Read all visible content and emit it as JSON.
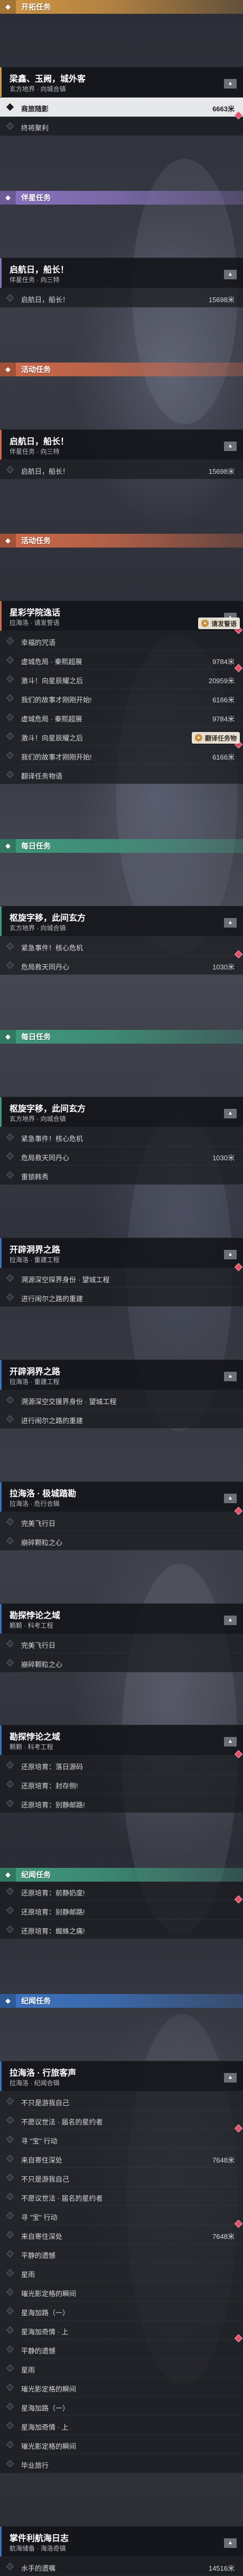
{
  "category_colors": {
    "trailblaze": "#d39744",
    "companion": "#8a74c0",
    "event": "#d06a4a",
    "daily": "#3f9b7e",
    "adventure": "#3c74c2",
    "theme": "#4e8f8a"
  },
  "location_tags": [
    "请发誓语",
    "翻译任务物"
  ],
  "rows": [
    {
      "type": "cat",
      "style": "trailblaze",
      "icon": "⬥",
      "label": "开拓任务"
    },
    {
      "type": "head",
      "style": "trailblaze",
      "title": "梁鑫、玉阙，城外客",
      "subtitle": "玄方地界 · 向城合镇"
    },
    {
      "type": "item",
      "text": "商旅随影",
      "dist": "6663米",
      "selected": true
    },
    {
      "type": "item",
      "text": "终将聚利",
      "dist": ""
    },
    {
      "type": "cat",
      "style": "companion",
      "icon": "⬥",
      "label": "伴星任务"
    },
    {
      "type": "head",
      "style": "companion",
      "title": "启航日，船长！",
      "subtitle": "伴星任务 · 向三特"
    },
    {
      "type": "item",
      "text": "启航日，船长！",
      "dist": "15698米",
      "selected": false
    },
    {
      "type": "cat",
      "style": "event",
      "icon": "⬥",
      "label": "活动任务"
    },
    {
      "type": "head",
      "style": "event",
      "title": "启航日，船长！",
      "subtitle": "伴星任务 · 向三特"
    },
    {
      "type": "item",
      "text": "启航日，船长！",
      "dist": "15698米",
      "selected": false
    },
    {
      "type": "cat",
      "style": "event",
      "icon": "⬥",
      "label": "活动任务"
    },
    {
      "type": "head",
      "style": "event",
      "title": "星彩学院逸话",
      "subtitle": "拉海洛 · 请发誓语"
    },
    {
      "type": "item",
      "text": "幸福的咒语",
      "dist": "",
      "selected": false
    },
    {
      "type": "item",
      "text": "虚城危局 · 秦熙超展",
      "dist": "9784米",
      "selected": false
    },
    {
      "type": "item",
      "text": "激斗！向星辰耀之后",
      "dist": "20959米",
      "selected": false
    },
    {
      "type": "item",
      "text": "我们的故事才刚刚开始!",
      "dist": "6166米",
      "selected": false
    },
    {
      "type": "item",
      "text": "虚城危局 · 秦熙超展",
      "dist": "9784米",
      "selected": false
    },
    {
      "type": "item",
      "text": "激斗！向星辰耀之后",
      "dist": "20959米",
      "selected": false
    },
    {
      "type": "item",
      "text": "我们的故事才刚刚开始!",
      "dist": "6166米",
      "selected": false
    },
    {
      "type": "item",
      "text": "翻译任务物语",
      "dist": "",
      "selected": false
    },
    {
      "type": "cat",
      "style": "daily",
      "icon": "⬥",
      "label": "每日任务"
    },
    {
      "type": "head",
      "style": "daily",
      "title": "枢旋字移，此间玄方",
      "subtitle": "玄方地界 · 向城合镇"
    },
    {
      "type": "item",
      "text": "紧急事件！核心危机",
      "dist": "",
      "selected": false
    },
    {
      "type": "item",
      "text": "危局救天同丹心",
      "dist": "1030米",
      "selected": false
    },
    {
      "type": "cat",
      "style": "daily",
      "icon": "⬥",
      "label": "每日任务"
    },
    {
      "type": "head",
      "style": "daily",
      "title": "枢旋字移，此间玄方",
      "subtitle": "玄方地界 · 向城合镇"
    },
    {
      "type": "item",
      "text": "紧急事件！核心危机",
      "dist": "",
      "selected": false
    },
    {
      "type": "item",
      "text": "危局救天同丹心",
      "dist": "1030米",
      "selected": false
    },
    {
      "type": "item",
      "text": "重锁韩秀",
      "dist": "",
      "selected": false
    },
    {
      "type": "head",
      "style": "adventure",
      "title": "开辟洞界之路",
      "subtitle": "拉海洛 · 重建工程"
    },
    {
      "type": "item",
      "text": "溯源深空探界身份 · 望城工程",
      "dist": "",
      "selected": false
    },
    {
      "type": "item",
      "text": "进行闹尔之路的重建",
      "dist": "",
      "selected": false
    },
    {
      "type": "head",
      "style": "adventure",
      "title": "开辟洞界之路",
      "subtitle": "拉海洛 · 重建工程"
    },
    {
      "type": "item",
      "text": "溯源深空交援界身份 · 望城工程",
      "dist": "",
      "selected": false
    },
    {
      "type": "item",
      "text": "进行闹尔之路的重建",
      "dist": "",
      "selected": false
    },
    {
      "type": "head",
      "style": "adventure",
      "title": "拉海洛 · 极城踏勘",
      "subtitle": "拉海洛 · 危行合辑"
    },
    {
      "type": "item",
      "text": "完美飞行日",
      "dist": "",
      "selected": false
    },
    {
      "type": "item",
      "text": "崩碎颗粒之心",
      "dist": "",
      "selected": false
    },
    {
      "type": "head",
      "style": "adventure",
      "title": "勘探悖论之域",
      "subtitle": "颗颗 · 科考工程"
    },
    {
      "type": "item",
      "text": "完美飞行日",
      "dist": "",
      "selected": false
    },
    {
      "type": "item",
      "text": "崩碎颗粒之心",
      "dist": "",
      "selected": false
    },
    {
      "type": "head",
      "style": "adventure",
      "title": "勘探悖论之域",
      "subtitle": "颗颗 · 科考工程"
    },
    {
      "type": "item",
      "text": "还原培育：落日源码",
      "dist": "",
      "selected": false
    },
    {
      "type": "item",
      "text": "还原培育：封存侧!",
      "dist": "",
      "selected": false
    },
    {
      "type": "item",
      "text": "还原培育：别静邮路!",
      "dist": "",
      "selected": false
    },
    {
      "type": "cat",
      "style": "daily",
      "icon": "⬥",
      "label": "纪闻任务"
    },
    {
      "type": "item",
      "text": "还原培育：前静奶度!",
      "dist": "",
      "selected": false
    },
    {
      "type": "item",
      "text": "还原培育：别静邮路!",
      "dist": "",
      "selected": false
    },
    {
      "type": "item",
      "text": "还原培育：蜘蛛之痛!",
      "dist": "",
      "selected": false
    },
    {
      "type": "cat",
      "style": "adventure",
      "icon": "⬥",
      "label": "纪闻任务"
    },
    {
      "type": "head",
      "style": "adventure",
      "title": "拉海洛 · 行旅客声",
      "subtitle": "拉海洛 · 纪闻合辑"
    },
    {
      "type": "item",
      "text": "不只是游我自己",
      "dist": "",
      "selected": false
    },
    {
      "type": "item",
      "text": "不愿议世法 · 届名的星约者",
      "dist": "",
      "selected": false
    },
    {
      "type": "item",
      "text": "寻 \"宝\" 行动",
      "dist": "",
      "selected": false
    },
    {
      "type": "item",
      "text": "来自寄住深处",
      "dist": "7648米",
      "selected": false
    },
    {
      "type": "item",
      "text": "不只是游我自己",
      "dist": "",
      "selected": false
    },
    {
      "type": "item",
      "text": "不愿议世法 · 届名的星约者",
      "dist": "",
      "selected": false
    },
    {
      "type": "item",
      "text": "寻 \"宝\" 行动",
      "dist": "",
      "selected": false
    },
    {
      "type": "item",
      "text": "来自寄住深处",
      "dist": "7648米",
      "selected": false
    },
    {
      "type": "item",
      "text": "平静的遗憾",
      "dist": "",
      "selected": false
    },
    {
      "type": "item",
      "text": "星雨",
      "dist": "",
      "selected": false
    },
    {
      "type": "item",
      "text": "璀光影定格的瞬间",
      "dist": "",
      "selected": false
    },
    {
      "type": "item",
      "text": "星海加路（一）",
      "dist": "",
      "selected": false
    },
    {
      "type": "item",
      "text": "星海加奇情 · 上",
      "dist": "",
      "selected": false
    },
    {
      "type": "item",
      "text": "平静的遗憾",
      "dist": "",
      "selected": false
    },
    {
      "type": "item",
      "text": "星雨",
      "dist": "",
      "selected": false
    },
    {
      "type": "item",
      "text": "璀光影定格的瞬间",
      "dist": "",
      "selected": false
    },
    {
      "type": "item",
      "text": "星海加路（一）",
      "dist": "",
      "selected": false
    },
    {
      "type": "item",
      "text": "星海加奇情 · 上",
      "dist": "",
      "selected": false
    },
    {
      "type": "item",
      "text": "璀光影定格的瞬间",
      "dist": "",
      "selected": false
    },
    {
      "type": "item",
      "text": "毕业旅行",
      "dist": "",
      "selected": false
    },
    {
      "type": "head",
      "style": "adventure",
      "title": "掌件利航海日志",
      "subtitle": "航海储备 · 海洛奇镇"
    },
    {
      "type": "item",
      "text": "水手的遗嘱",
      "dist": "14516米",
      "selected": false
    }
  ]
}
